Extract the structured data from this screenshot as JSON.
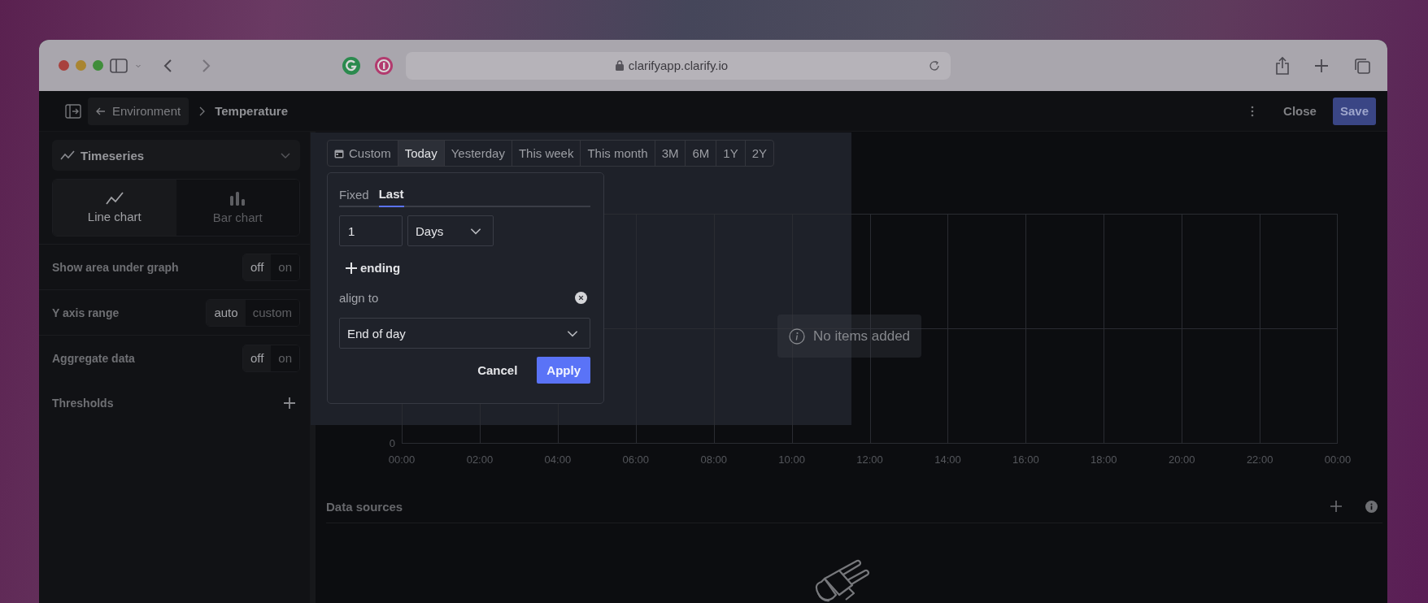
{
  "browser": {
    "url": "clarifyapp.clarify.io"
  },
  "header": {
    "back_label": "Environment",
    "breadcrumb": "Temperature",
    "buttons": [
      {
        "label": "Close",
        "kind": "plain"
      },
      {
        "label": "Save",
        "kind": "primary"
      }
    ]
  },
  "sidebar": {
    "visualization": "Timeseries",
    "chart_types": [
      {
        "label": "Line chart",
        "kind": "line",
        "selected": true
      },
      {
        "label": "Bar chart",
        "kind": "bar",
        "selected": false
      }
    ],
    "settings": [
      {
        "label": "Show area under graph",
        "kind": "toggle",
        "options": [
          {
            "label": "off",
            "selected": true
          },
          {
            "label": "on",
            "selected": false
          }
        ]
      },
      {
        "label": "Y axis range",
        "kind": "toggle",
        "options": [
          {
            "label": "auto",
            "selected": true
          },
          {
            "label": "custom",
            "selected": false
          }
        ]
      },
      {
        "label": "Aggregate data",
        "kind": "toggle",
        "options": [
          {
            "label": "off",
            "selected": true
          },
          {
            "label": "on",
            "selected": false
          }
        ]
      },
      {
        "label": "Thresholds",
        "kind": "add"
      }
    ]
  },
  "time_range": {
    "options": [
      {
        "label": "Custom",
        "kind": "custom",
        "selected": false
      },
      {
        "label": "Today",
        "kind": "preset",
        "selected": true
      },
      {
        "label": "Yesterday",
        "kind": "preset",
        "selected": false
      },
      {
        "label": "This week",
        "kind": "preset",
        "selected": false
      },
      {
        "label": "This month",
        "kind": "preset",
        "selected": false
      },
      {
        "label": "3M",
        "kind": "preset",
        "selected": false
      },
      {
        "label": "6M",
        "kind": "preset",
        "selected": false
      },
      {
        "label": "1Y",
        "kind": "preset",
        "selected": false
      },
      {
        "label": "2Y",
        "kind": "preset",
        "selected": false
      }
    ]
  },
  "popover": {
    "tabs": [
      {
        "label": "Fixed",
        "selected": false
      },
      {
        "label": "Last",
        "selected": true
      }
    ],
    "amount": "1",
    "unit": "Days",
    "ending_label": "ending",
    "align_label": "align to",
    "align_value": "End of day",
    "buttons": [
      {
        "label": "Cancel",
        "kind": "plain"
      },
      {
        "label": "Apply",
        "kind": "primary"
      }
    ]
  },
  "chart": {
    "y_labels": [
      "0"
    ],
    "x_labels": [
      "00:00",
      "02:00",
      "04:00",
      "06:00",
      "08:00",
      "10:00",
      "12:00",
      "14:00",
      "16:00",
      "18:00",
      "20:00",
      "22:00",
      "00:00"
    ],
    "message": "No items added"
  },
  "data_sources": {
    "title": "Data sources"
  }
}
